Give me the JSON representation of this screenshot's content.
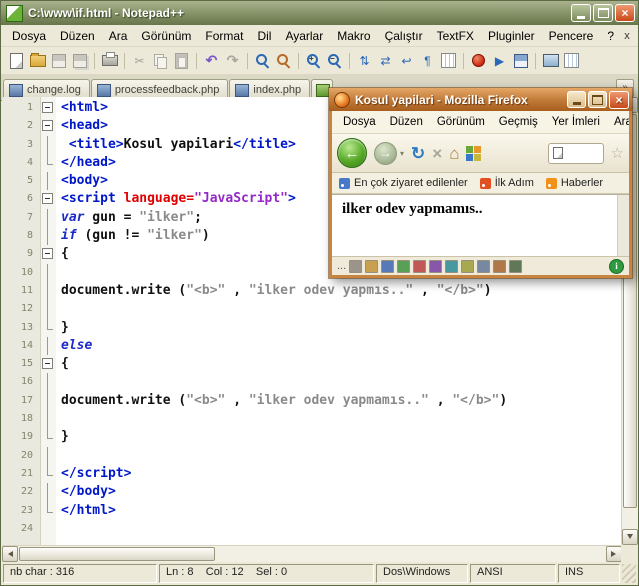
{
  "notepad": {
    "title": "C:\\www\\if.html - Notepad++",
    "window_buttons": {
      "close": "×"
    },
    "menu": [
      "Dosya",
      "Düzen",
      "Ara",
      "Görünüm",
      "Format",
      "Dil",
      "Ayarlar",
      "Makro",
      "Çalıştır",
      "TextFX",
      "Pluginler",
      "Pencere",
      "?"
    ],
    "menu_close": "x",
    "toolbar": [
      {
        "name": "new-file-icon",
        "kind": "page"
      },
      {
        "name": "open-file-icon",
        "kind": "folder"
      },
      {
        "name": "save-file-icon",
        "kind": "floppy",
        "disabled": true
      },
      {
        "name": "save-all-icon",
        "kind": "floppy2",
        "disabled": true
      },
      {
        "sep": true
      },
      {
        "name": "print-icon",
        "kind": "printer"
      },
      {
        "sep": true
      },
      {
        "name": "cut-icon",
        "kind": "cut",
        "disabled": true
      },
      {
        "name": "copy-icon",
        "kind": "copy",
        "disabled": true
      },
      {
        "name": "paste-icon",
        "kind": "paste",
        "disabled": true
      },
      {
        "sep": true
      },
      {
        "name": "undo-icon",
        "kind": "undo"
      },
      {
        "name": "redo-icon",
        "kind": "redo",
        "disabled": true
      },
      {
        "sep": true
      },
      {
        "name": "find-icon",
        "kind": "mag"
      },
      {
        "name": "replace-icon",
        "kind": "magr"
      },
      {
        "sep": true
      },
      {
        "name": "zoom-in-icon",
        "kind": "magp"
      },
      {
        "name": "zoom-out-icon",
        "kind": "magm"
      },
      {
        "sep": true
      },
      {
        "name": "sync-vertical-icon",
        "kind": "syncv"
      },
      {
        "name": "sync-horizontal-icon",
        "kind": "synch"
      },
      {
        "name": "word-wrap-icon",
        "kind": "wrap"
      },
      {
        "name": "show-symbols-icon",
        "kind": "pilcrow"
      },
      {
        "name": "indent-guide-icon",
        "kind": "guide"
      },
      {
        "sep": true
      },
      {
        "name": "record-macro-icon",
        "kind": "record"
      },
      {
        "name": "play-macro-icon",
        "kind": "play"
      },
      {
        "name": "save-macro-icon",
        "kind": "floppyc"
      },
      {
        "sep": true
      },
      {
        "name": "doc-map-icon",
        "kind": "monitor"
      },
      {
        "name": "function-list-icon",
        "kind": "guide"
      }
    ],
    "tabs": [
      {
        "label": "change.log"
      },
      {
        "label": "processfeedback.php"
      },
      {
        "label": "index.php"
      }
    ],
    "tab_overflow": "»",
    "code": [
      {
        "f": "box",
        "s": [
          [
            "<html>",
            "tag"
          ]
        ]
      },
      {
        "f": "box",
        "s": [
          [
            "<head>",
            "tag"
          ]
        ]
      },
      {
        "f": "v",
        "s": [
          [
            " ",
            "pln"
          ],
          [
            "<title>",
            "tag"
          ],
          [
            "Kosul yapilari",
            "txt"
          ],
          [
            "</title>",
            "tag"
          ]
        ]
      },
      {
        "f": "end",
        "s": [
          [
            "</head>",
            "tag"
          ]
        ]
      },
      {
        "f": "v",
        "s": [
          [
            "<body>",
            "tag"
          ]
        ]
      },
      {
        "f": "box",
        "s": [
          [
            "<script ",
            "tag"
          ],
          [
            "language=",
            "attr"
          ],
          [
            "\"JavaScript\"",
            "val"
          ],
          [
            ">",
            "tag"
          ]
        ]
      },
      {
        "f": "v",
        "s": [
          [
            "var",
            "kw"
          ],
          [
            " gun = ",
            "pln"
          ],
          [
            "\"ilker\"",
            "str"
          ],
          [
            ";",
            "pln"
          ]
        ]
      },
      {
        "f": "v",
        "s": [
          [
            "if",
            "kw"
          ],
          [
            " (gun != ",
            "pln"
          ],
          [
            "\"ilker\"",
            "str"
          ],
          [
            ")",
            "pln"
          ]
        ]
      },
      {
        "f": "box",
        "s": [
          [
            "{",
            "pln"
          ]
        ]
      },
      {
        "f": "v",
        "s": []
      },
      {
        "f": "v",
        "s": [
          [
            "document.write (",
            "pln"
          ],
          [
            "\"<b>\"",
            "str"
          ],
          [
            " , ",
            "pln"
          ],
          [
            "\"ilker odev yapmıs..\"",
            "str"
          ],
          [
            " , ",
            "pln"
          ],
          [
            "\"</b>\"",
            "str"
          ],
          [
            ")",
            "pln"
          ]
        ]
      },
      {
        "f": "v",
        "s": []
      },
      {
        "f": "end",
        "s": [
          [
            "}",
            "pln"
          ]
        ]
      },
      {
        "f": "v",
        "s": [
          [
            "else",
            "kw"
          ]
        ]
      },
      {
        "f": "box",
        "s": [
          [
            "{",
            "pln"
          ]
        ]
      },
      {
        "f": "v",
        "s": []
      },
      {
        "f": "v",
        "s": [
          [
            "document.write (",
            "pln"
          ],
          [
            "\"<b>\"",
            "str"
          ],
          [
            " , ",
            "pln"
          ],
          [
            "\"ilker odev yapmamıs..\"",
            "str"
          ],
          [
            " , ",
            "pln"
          ],
          [
            "\"</b>\"",
            "str"
          ],
          [
            ")",
            "pln"
          ]
        ]
      },
      {
        "f": "v",
        "s": []
      },
      {
        "f": "end",
        "s": [
          [
            "}",
            "pln"
          ]
        ]
      },
      {
        "f": "v",
        "s": []
      },
      {
        "f": "end",
        "s": [
          [
            "</script>",
            "tag"
          ]
        ]
      },
      {
        "f": "v",
        "s": [
          [
            "</body>",
            "tag"
          ]
        ]
      },
      {
        "f": "end",
        "s": [
          [
            "</html>",
            "tag"
          ]
        ]
      },
      {
        "f": "",
        "s": []
      }
    ],
    "status": {
      "chars": "nb char : 316",
      "position": "Ln : 8    Col : 12    Sel : 0",
      "eol": "Dos\\Windows",
      "encoding": "ANSI",
      "mode": "INS"
    }
  },
  "firefox": {
    "title": "Kosul yapilari - Mozilla Firefox",
    "window_buttons": {
      "close": "×"
    },
    "menu": [
      "Dosya",
      "Düzen",
      "Görünüm",
      "Geçmiş",
      "Yer İmleri",
      "Araçlar"
    ],
    "nav": {
      "back": "←",
      "forward": "→",
      "dropdown": "▾",
      "refresh": "↻",
      "stop": "×",
      "home": "⌂",
      "star": "☆"
    },
    "bookmarks": [
      {
        "label": "En çok ziyaret edilenler",
        "color": "#4878c8"
      },
      {
        "label": "İlk Adım",
        "color": "#e05020"
      },
      {
        "label": "Haberler",
        "color": "#f39018"
      }
    ],
    "content_text": "ilker odev yapmamıs..",
    "statusbar": {
      "ellipsis": "...",
      "info": "i",
      "icons": [
        {
          "name": "plugin-icon-1",
          "color": "#9a948a"
        },
        {
          "name": "plugin-icon-2",
          "color": "#c8a050"
        },
        {
          "name": "plugin-icon-3",
          "color": "#5878b8"
        },
        {
          "name": "plugin-icon-4",
          "color": "#58a058"
        },
        {
          "name": "plugin-icon-5",
          "color": "#c05858"
        },
        {
          "name": "plugin-icon-6",
          "color": "#8858a8"
        },
        {
          "name": "plugin-icon-7",
          "color": "#4898a0"
        },
        {
          "name": "plugin-icon-8",
          "color": "#a8a850"
        },
        {
          "name": "plugin-icon-9",
          "color": "#7888a0"
        },
        {
          "name": "plugin-icon-10",
          "color": "#b07848"
        },
        {
          "name": "plugin-icon-11",
          "color": "#607858"
        }
      ]
    }
  }
}
